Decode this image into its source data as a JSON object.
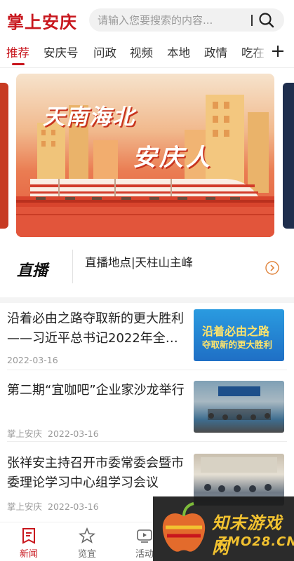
{
  "header": {
    "logo": "掌上安庆",
    "search_placeholder": "请输入您要搜索的内容..."
  },
  "tabs": [
    {
      "label": "推荐"
    },
    {
      "label": "安庆号"
    },
    {
      "label": "问政"
    },
    {
      "label": "视频"
    },
    {
      "label": "本地"
    },
    {
      "label": "政情"
    },
    {
      "label": "吃在"
    }
  ],
  "banner": {
    "title1": "天南海北",
    "title2": "安庆人"
  },
  "live": {
    "logo": "直播",
    "text": "直播地点|天柱山主峰"
  },
  "news": [
    {
      "title": "沿着必由之路夺取新的更大胜利——习近平总书记2022年全…",
      "source": "",
      "date": "2022-03-16",
      "thumb_text1": "沿着必由之路",
      "thumb_text2": "夺取新的更大胜利"
    },
    {
      "title": "第二期“宜咖吧”企业家沙龙举行",
      "source": "掌上安庆",
      "date": "2022-03-16"
    },
    {
      "title": "张祥安主持召开市委常委会暨市委理论学习中心组学习会议",
      "source": "掌上安庆",
      "date": "2022-03-16"
    }
  ],
  "bottom_nav": [
    {
      "label": "新闻",
      "icon": "news-icon",
      "active": true
    },
    {
      "label": "览宜",
      "icon": "star-icon",
      "active": false
    },
    {
      "label": "活动",
      "icon": "tv-icon",
      "active": false
    }
  ],
  "watermark": {
    "text1": "知末游戏网",
    "text2": "ZMO28.CN"
  },
  "colors": {
    "brand": "#c8161d",
    "tab_active": "#c8161d",
    "meta": "#9a9a9a"
  }
}
